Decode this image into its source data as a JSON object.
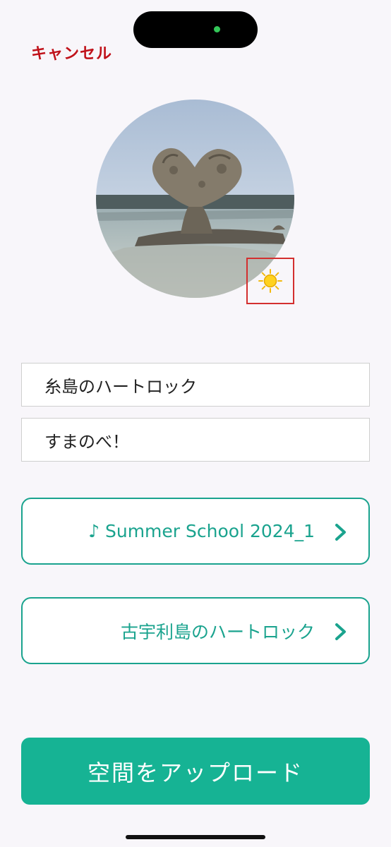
{
  "header": {
    "cancel_label": "キャンセル"
  },
  "photo": {
    "weather_icon": "sun-icon"
  },
  "form": {
    "title_value": "糸島のハートロック",
    "description_value": "すまのべ！"
  },
  "links": [
    {
      "label": "♪ Summer School 2024_1",
      "icon": "chevron-right-icon"
    },
    {
      "label": "古宇利島のハートロック",
      "icon": "chevron-right-icon"
    }
  ],
  "footer": {
    "upload_label": "空間をアップロード"
  },
  "colors": {
    "accent": "#16b394",
    "link": "#1aa38e",
    "cancel": "#c0121a",
    "highlight_box": "#d32f2f"
  }
}
